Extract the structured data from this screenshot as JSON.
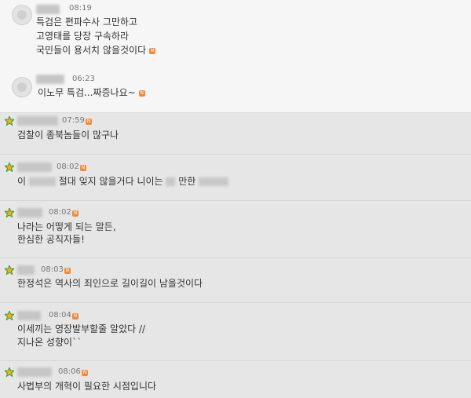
{
  "comments_top": [
    {
      "time": "08:19",
      "lines": [
        "특검은 편파수사 그만하고",
        "고영태를 당장 구속하라",
        "국민들이 용서치 않을것이다"
      ]
    },
    {
      "time": "06:23",
      "lines": [
        "이노무 특검...짜증나요~"
      ]
    }
  ],
  "comments": [
    {
      "time": "07:59",
      "lines": [
        "검찰이 종북놈들이 많구나"
      ]
    },
    {
      "time": "08:02",
      "lines": [
        "이 ",
        " 절대 잊지 않을거다 니이는 ",
        " 만한 "
      ]
    },
    {
      "time": "08:02",
      "lines": [
        "나라는 어떻게 되는 말든,",
        "한심한 공직자들!"
      ]
    },
    {
      "time": "08:03",
      "lines": [
        "한정석은 역사의 죄인으로 길이길이 남을것이다"
      ]
    },
    {
      "time": "08:04",
      "lines": [
        "이세끼는 영장발부할줄 알았다 //",
        "지나온 성향이``"
      ]
    },
    {
      "time": "08:06",
      "lines": [
        "사법부의 개혁이 필요한 시점입니다"
      ]
    }
  ],
  "new_badge": "N",
  "colors": {
    "badge": "#f08a38",
    "background": "#e6e6e6",
    "top_background": "#f6f6f6"
  }
}
